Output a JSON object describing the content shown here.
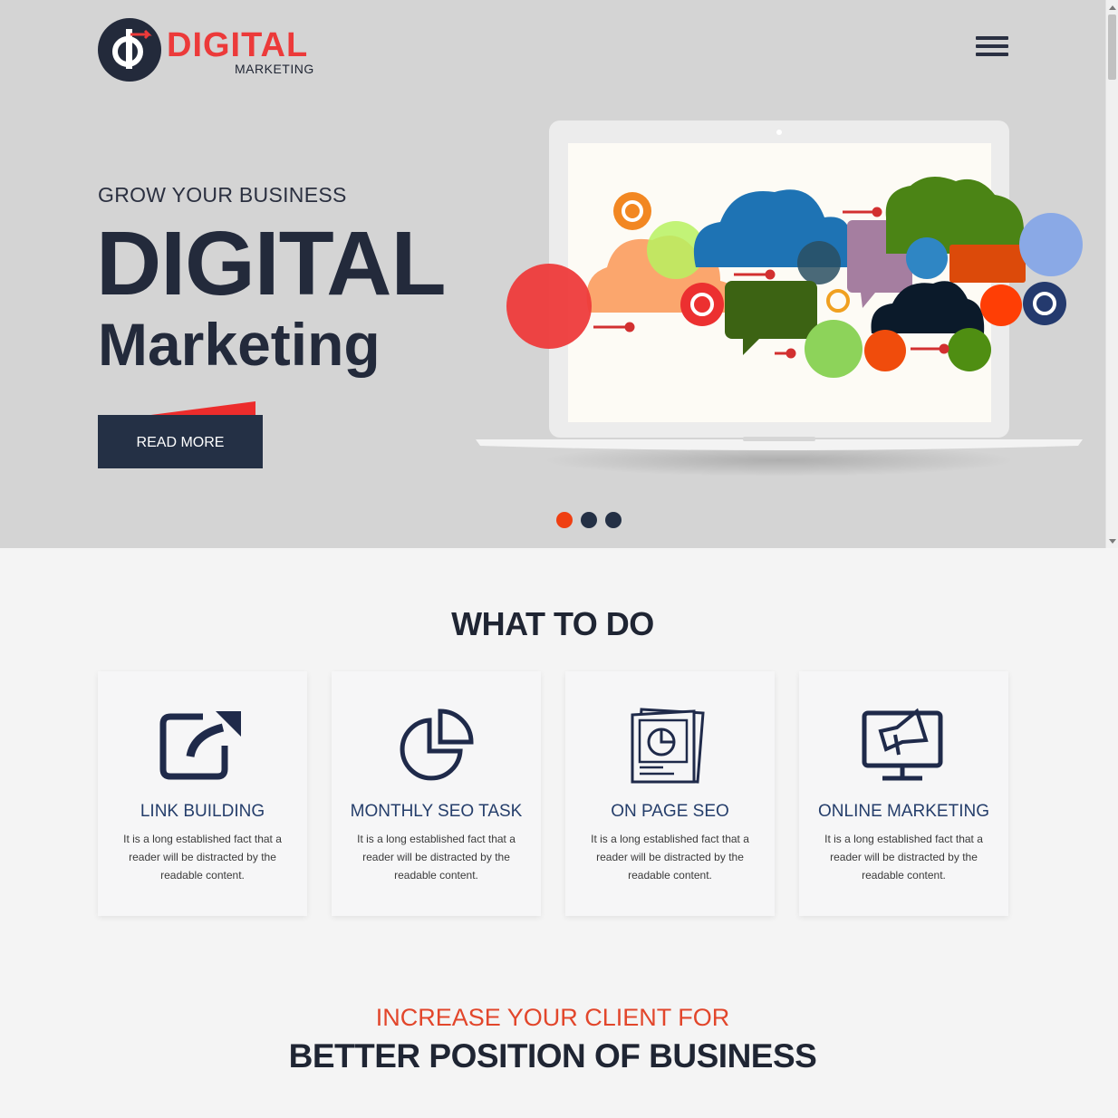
{
  "brand": {
    "name": "DIGITAL",
    "tagline": "MARKETING",
    "accent": "#ec3a3a",
    "navy": "#232a3b"
  },
  "header": {
    "menu_icon": "hamburger-menu-icon"
  },
  "hero": {
    "kicker": "GROW YOUR BUSINESS",
    "title": "DIGITAL",
    "subtitle": "Marketing",
    "cta_label": "READ MORE",
    "illustration_icon": "laptop-cloud-illustration",
    "slider": {
      "count": 3,
      "active": 0,
      "colors": [
        "#ef3f12",
        "#243045",
        "#243045"
      ]
    }
  },
  "services": {
    "title": "WHAT TO DO",
    "items": [
      {
        "icon": "external-link-icon",
        "title": "LINK BUILDING",
        "text": "It is a long established fact that a reader will be distracted by the readable content."
      },
      {
        "icon": "pie-chart-icon",
        "title": "MONTHLY SEO TASK",
        "text": "It is a long established fact that a reader will be distracted by the readable content."
      },
      {
        "icon": "seo-report-icon",
        "title": "ON PAGE SEO",
        "text": "It is a long established fact that a reader will be distracted by the readable content."
      },
      {
        "icon": "monitor-megaphone-icon",
        "title": "ONLINE MARKETING",
        "text": "It is a long established fact that a reader will be distracted by the readable content."
      }
    ]
  },
  "clients": {
    "kicker": "INCREASE YOUR CLIENT FOR",
    "title": "BETTER POSITION OF BUSINESS"
  }
}
